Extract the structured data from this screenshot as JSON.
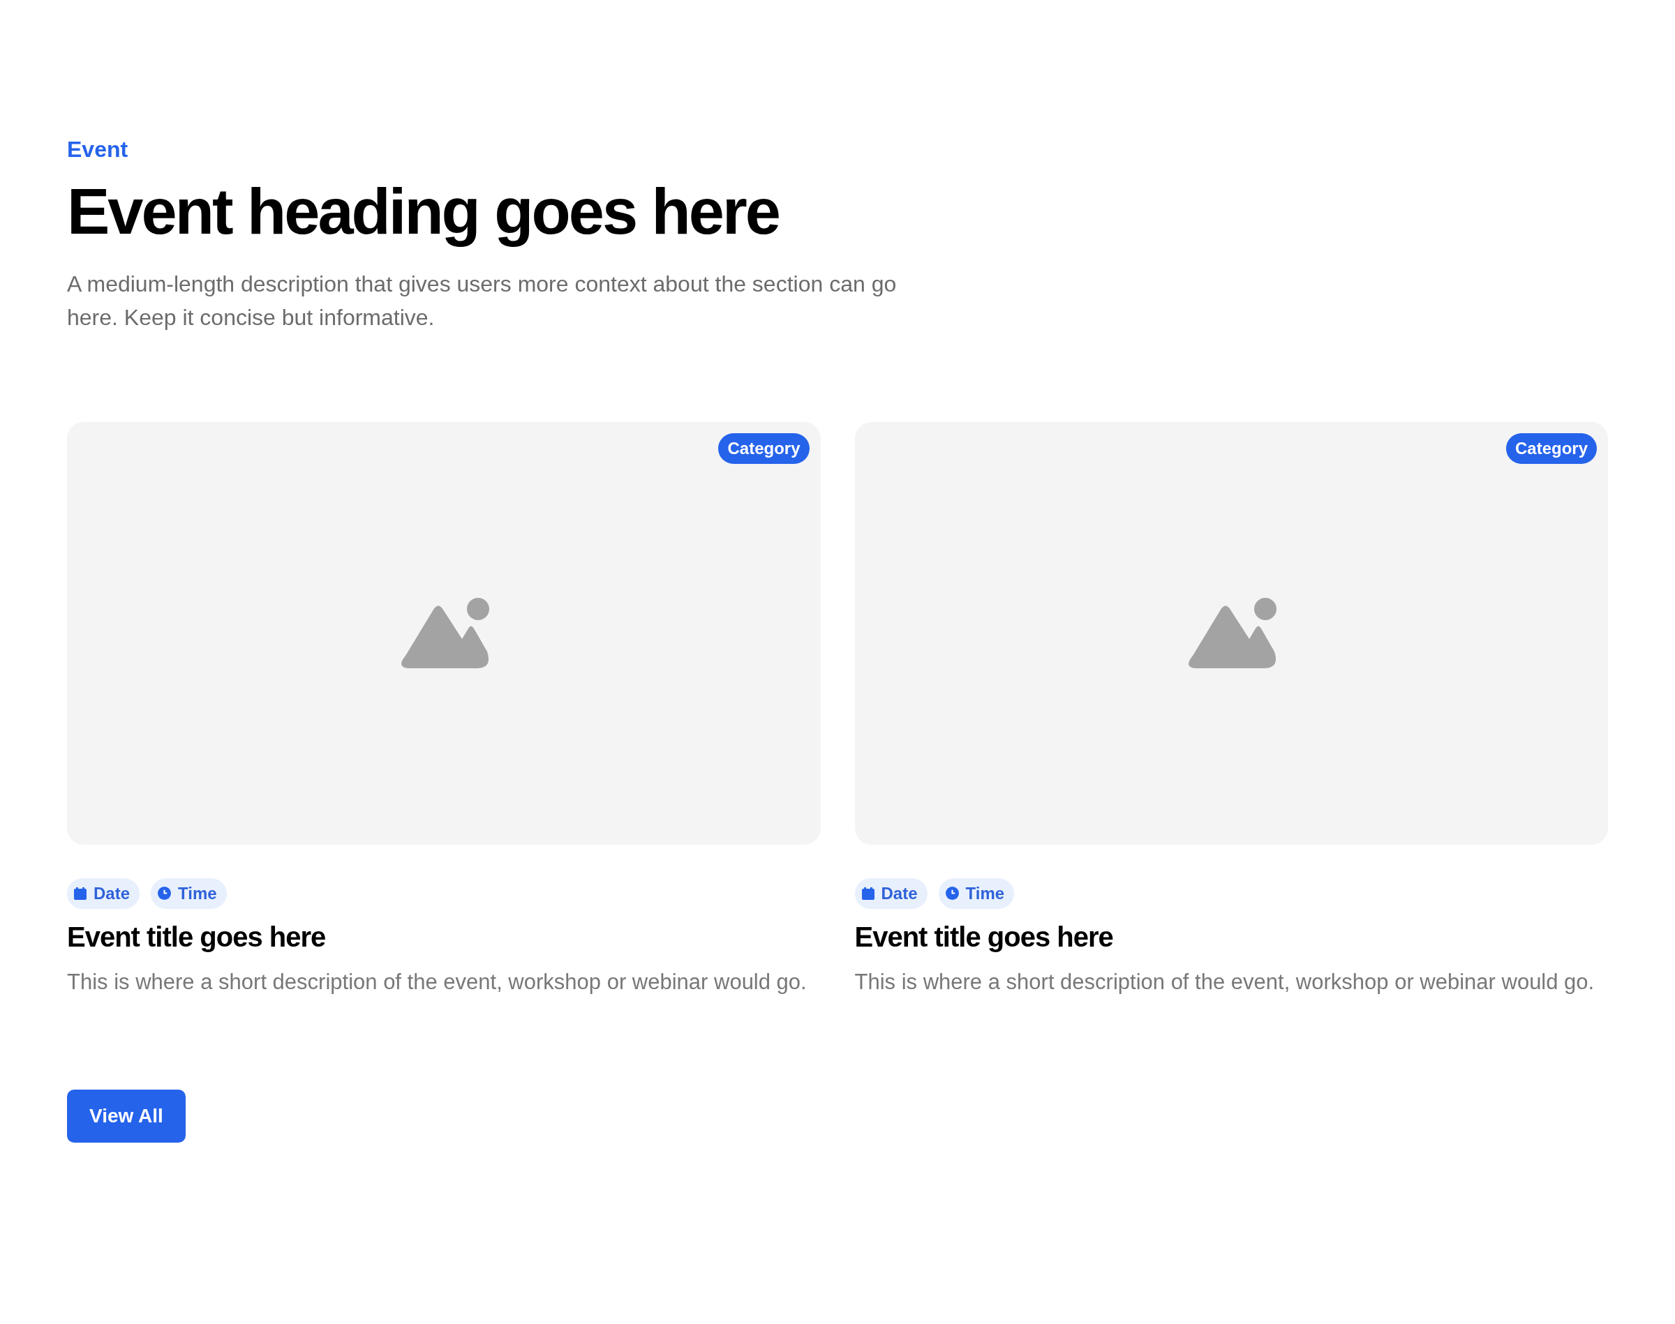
{
  "section": {
    "tagline": "Event",
    "heading": "Event heading goes here",
    "description": "A medium-length description that gives users more context about the section can go here. Keep it concise but informative."
  },
  "events": [
    {
      "category": "Category",
      "meta": [
        {
          "kind": "date",
          "label": "Date"
        },
        {
          "kind": "time",
          "label": "Time"
        }
      ],
      "title": "Event title goes here",
      "description": "This is where a short description of the event, workshop or webinar would go."
    },
    {
      "category": "Category",
      "meta": [
        {
          "kind": "date",
          "label": "Date"
        },
        {
          "kind": "time",
          "label": "Time"
        }
      ],
      "title": "Event title goes here",
      "description": "This is where a short description of the event, workshop or webinar would go."
    }
  ],
  "button": {
    "label": "View All"
  }
}
